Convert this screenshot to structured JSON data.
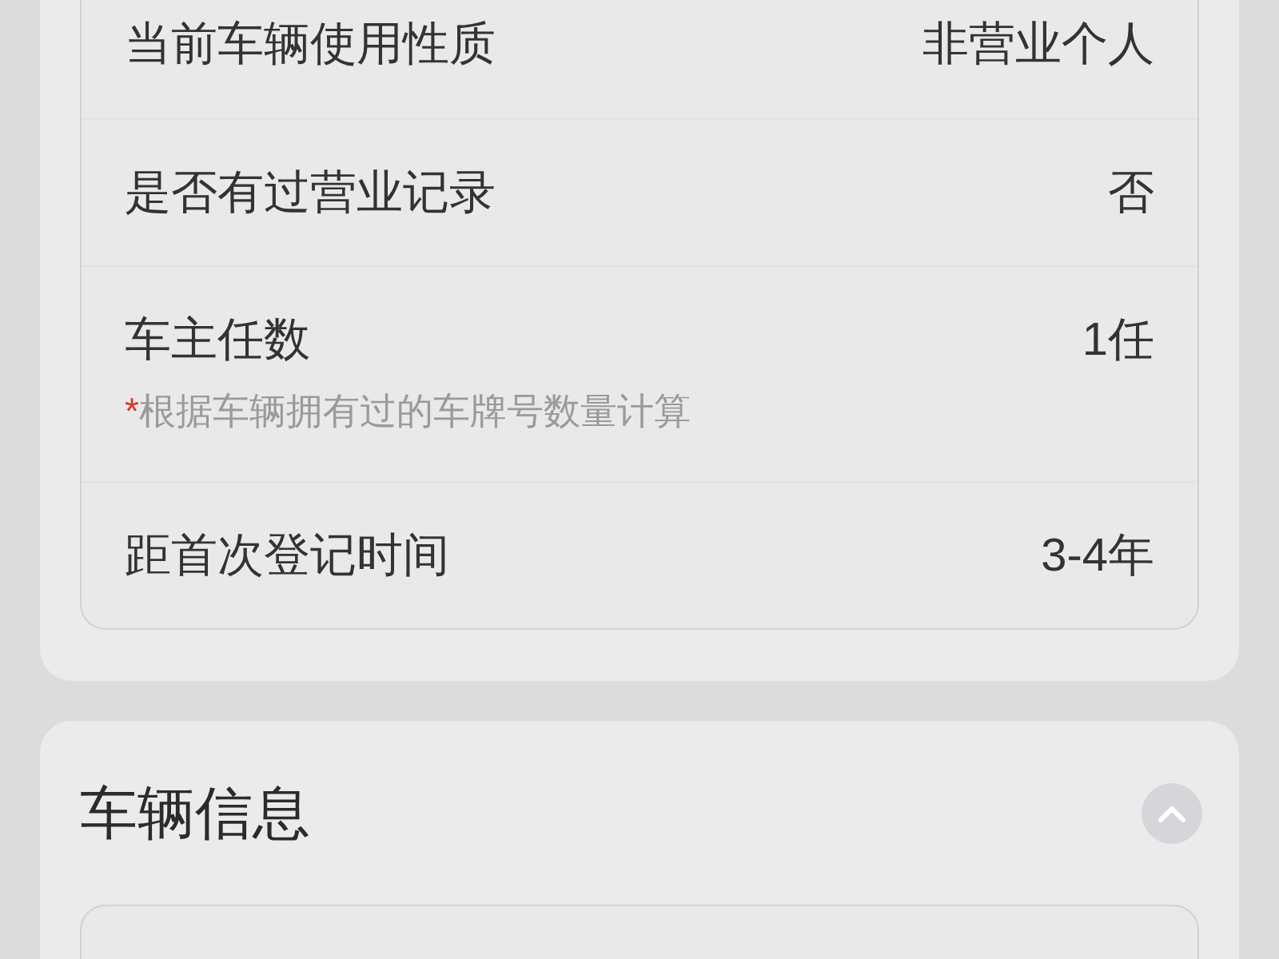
{
  "sections": [
    {
      "rows": [
        {
          "label": "当前车辆使用性质",
          "value": "非营业个人"
        },
        {
          "label": "是否有过营业记录",
          "value": "否"
        },
        {
          "label": "车主任数",
          "value": "1任",
          "note_mark": "*",
          "note": "根据车辆拥有过的车牌号数量计算"
        },
        {
          "label": "距首次登记时间",
          "value": "3-4年"
        }
      ]
    },
    {
      "title": "车辆信息",
      "expanded": true
    }
  ]
}
